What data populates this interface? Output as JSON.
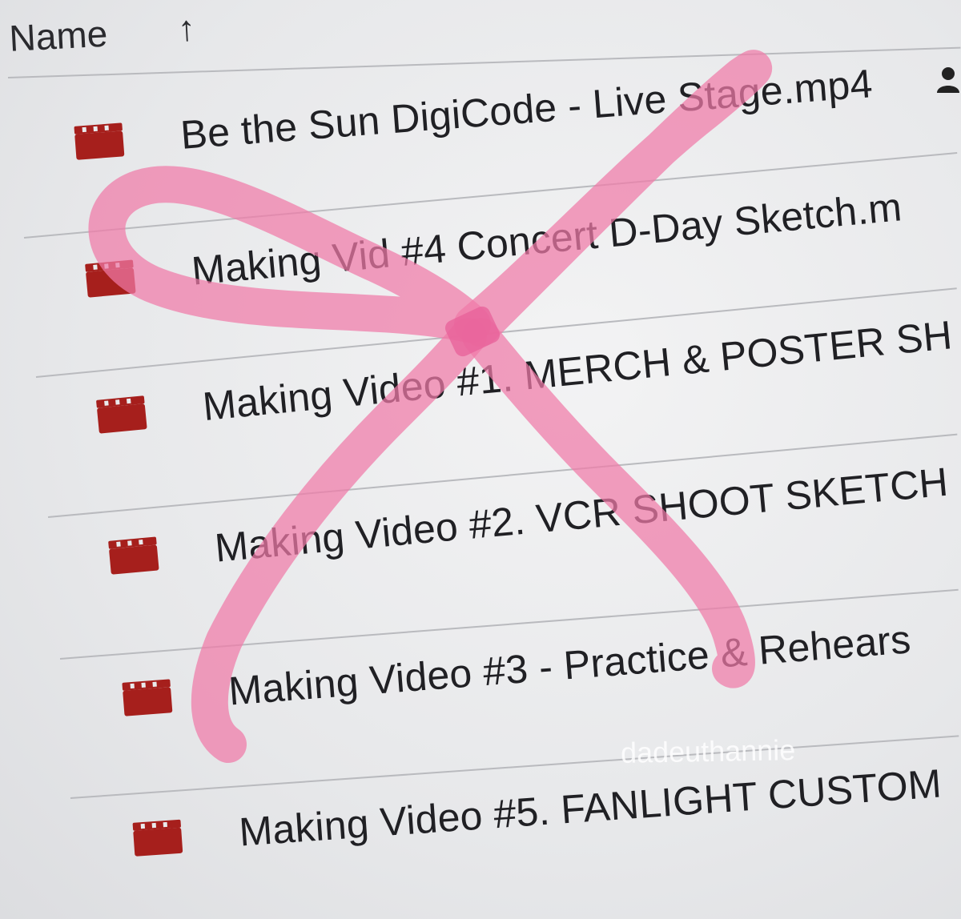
{
  "header": {
    "column_label": "Name",
    "sort_icon": "arrow-up-icon"
  },
  "files": [
    {
      "name": "Be the Sun DigiCode - Live Stage.mp4",
      "icon": "video-file-icon"
    },
    {
      "name": "Making Vid #4 Concert D-Day Sketch.m",
      "icon": "video-file-icon"
    },
    {
      "name": "Making Video #1. MERCH & POSTER SH",
      "icon": "video-file-icon"
    },
    {
      "name": "Making Video #2. VCR SHOOT SKETCH",
      "icon": "video-file-icon"
    },
    {
      "name": "Making Video #3 - Practice & Rehears",
      "icon": "video-file-icon"
    },
    {
      "name": "Making Video #5. FANLIGHT CUSTOM",
      "icon": "video-file-icon"
    }
  ],
  "shared_icon": "person-icon",
  "watermark": "dadeuthannie",
  "colors": {
    "file_icon": "#a61f1c",
    "ribbon": "#f07aa8",
    "background": "#e9eaec"
  }
}
